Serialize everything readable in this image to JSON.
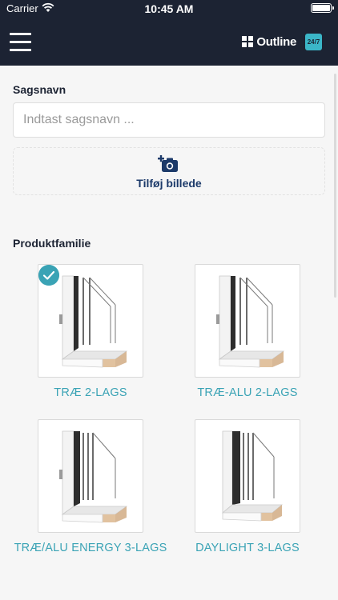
{
  "status": {
    "carrier": "Carrier",
    "time": "10:45 AM"
  },
  "header": {
    "brand": "Outline",
    "badge": "24/7"
  },
  "case": {
    "label": "Sagsnavn",
    "placeholder": "Indtast sagsnavn ..."
  },
  "add_photo": {
    "label": "Tilføj billede"
  },
  "family": {
    "label": "Produktfamilie",
    "products": [
      {
        "name": "TRÆ 2-LAGS",
        "selected": true,
        "panes": 2
      },
      {
        "name": "TRÆ-ALU 2-LAGS",
        "selected": false,
        "panes": 2
      },
      {
        "name": "TRÆ/ALU ENERGY 3-LAGS",
        "selected": false,
        "panes": 3
      },
      {
        "name": "DAYLIGHT 3-LAGS",
        "selected": false,
        "panes": 3
      }
    ]
  },
  "colors": {
    "nav_bg": "#1c2333",
    "accent": "#3aa3b5",
    "link": "#1c3a6a"
  }
}
